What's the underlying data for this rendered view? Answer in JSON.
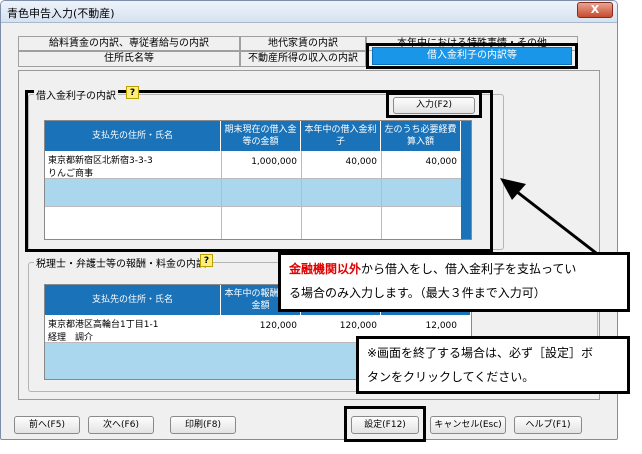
{
  "window": {
    "title": "青色申告入力(不動産)",
    "close": "X"
  },
  "tabs": {
    "top": [
      "給料賃金の内訳、専従者給与の内訳",
      "地代家賃の内訳",
      "本年中における特殊事情・その他"
    ],
    "bottom": [
      "住所氏名等",
      "不動産所得の収入の内訳",
      "借入金利子の内訳等"
    ]
  },
  "interest": {
    "label": "借入金利子の内訳",
    "input_button": "入力(F2)",
    "headers": [
      "支払先の住所・氏名",
      "期末現在の借入金等の金額",
      "本年中の借入金利子",
      "左のうち必要経費算入額"
    ],
    "row": {
      "address": "東京都新宿区北新宿3-3-3",
      "name": "りんご商事",
      "balance": "1,000,000",
      "interest": "40,000",
      "expense": "40,000"
    }
  },
  "fees": {
    "label": "税理士・弁護士等の報酬・料金の内訳",
    "headers": [
      "支払先の住所・氏名",
      "本年中の報酬等の金額",
      "",
      ""
    ],
    "row": {
      "address": "東京都港区高輪台1丁目1-1",
      "name": "経理　調介",
      "amount": "120,000",
      "amount2": "120,000",
      "amount3": "12,000"
    }
  },
  "callout1": {
    "red": "金融機関以外",
    "line1": "から借入をし、借入金利子を支払ってい",
    "line2": "る場合のみ入力します。（最大３件まで入力可）"
  },
  "callout2": {
    "line1": "※画面を終了する場合は、必ず［設定］ボ",
    "line2": "タンをクリックしてください。"
  },
  "footer": {
    "prev": "前へ(F5)",
    "next": "次へ(F6)",
    "print": "印刷(F8)",
    "set": "設定(F12)",
    "cancel": "キャンセル(Esc)",
    "help": "ヘルプ(F1)"
  }
}
